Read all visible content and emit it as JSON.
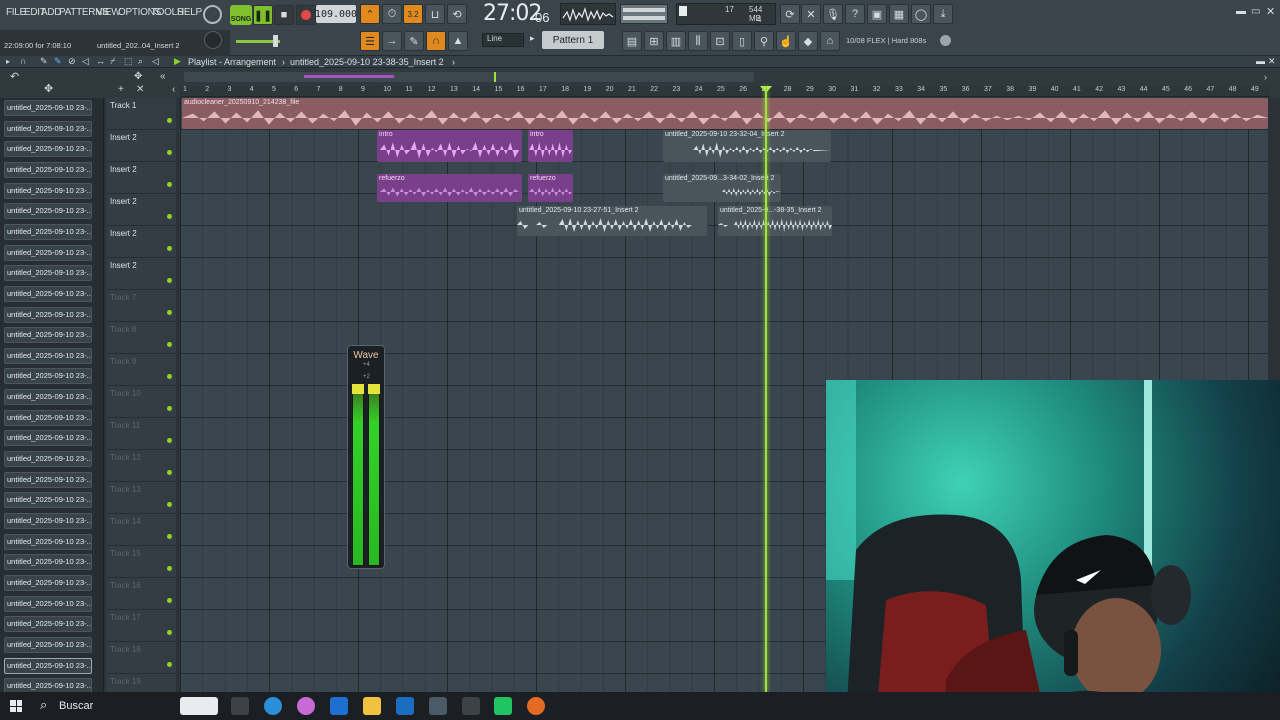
{
  "menu": [
    "FILE",
    "EDIT",
    "ADD",
    "PATTERNS",
    "VIEW",
    "OPTIONS",
    "TOOLS",
    "HELP"
  ],
  "transport": {
    "song_label": "SONG",
    "tempo": "109.000",
    "time_main": "27:02",
    "time_sub": "06"
  },
  "cpu": {
    "value1": "17",
    "ram": "544 MB",
    "value2": "4"
  },
  "hint": {
    "time": "22:09:00 for 7:08:10",
    "file": "untitled_202..04_Insert 2"
  },
  "pattern": {
    "snap": "Line",
    "selected": "Pattern 1"
  },
  "plugin_info": "10/08 FLEX | Hard 808s",
  "playlist": {
    "title": "Playlist - Arrangement",
    "separator": "›",
    "arrangement": "untitled_2025-09-10 23-38-35_Insert 2"
  },
  "ruler": [
    "1",
    "2",
    "3",
    "4",
    "5",
    "6",
    "7",
    "8",
    "9",
    "10",
    "11",
    "12",
    "13",
    "14",
    "15",
    "16",
    "17",
    "18",
    "19",
    "20",
    "21",
    "22",
    "23",
    "24",
    "25",
    "26",
    "27",
    "28",
    "29",
    "30",
    "31",
    "32",
    "33",
    "34",
    "35",
    "36",
    "37",
    "38",
    "39",
    "40",
    "41",
    "42",
    "43",
    "44",
    "45",
    "46",
    "47",
    "48",
    "49"
  ],
  "sidebar": [
    "untitled_2025-09-10 23-...",
    "untitled_2025-09-10 23-...",
    "untitled_2025-09-10 23-...",
    "untitled_2025-09-10 23-...",
    "untitled_2025-09-10 23-...",
    "untitled_2025-09-10 23-...",
    "untitled_2025-09-10 23-...",
    "untitled_2025-09-10 23-...",
    "untitled_2025-09-10 23-...",
    "untitled_2025-09-10 23-...",
    "untitled_2025-09-10 23-...",
    "untitled_2025-09-10 23-...",
    "untitled_2025-09-10 23-...",
    "untitled_2025-09-10 23-...",
    "untitled_2025-09-10 23-...",
    "untitled_2025-09-10 23-...",
    "untitled_2025-09-10 23-...",
    "untitled_2025-09-10 23-...",
    "untitled_2025-09-10 23-...",
    "untitled_2025-09-10 23-...",
    "untitled_2025-09-10 23-...",
    "untitled_2025-09-10 23-...",
    "untitled_2025-09-10 23-...",
    "untitled_2025-09-10 23-...",
    "untitled_2025-09-10 23-...",
    "untitled_2025-09-10 23-...",
    "untitled_2025-09-10 23-...",
    "untitled_2025-09-10 23-...",
    "untitled_2025-09-10 23-..."
  ],
  "tracks": [
    "Track 1",
    "Insert 2",
    "Insert 2",
    "Insert 2",
    "Insert 2",
    "Insert 2",
    "Track 7",
    "Track 8",
    "Track 9",
    "Track 10",
    "Track 11",
    "Track 12",
    "Track 13",
    "Track 14",
    "Track 15",
    "Track 16",
    "Track 17",
    "Track 18",
    "Track 19"
  ],
  "clips": {
    "audio": "audiocleaner_20250910_214238_file",
    "intro1": "intro",
    "intro2": "intro",
    "refuerzo1": "refuerzo",
    "refuerzo2": "refuerzo",
    "u1": "untitled_2025-09-10 23-32-04_Insert 2",
    "u2": "untitled_2025-09...3-34-02_Insert 2",
    "u3": "untitled_2025-09-10 23-27-51_Insert 2",
    "u4": "untitled_2025-0...-38-35_Insert 2"
  },
  "meter": {
    "title": "Wave",
    "scale_top": "+4",
    "scale_mid": "+2"
  },
  "taskbar": {
    "search": "Buscar"
  },
  "colors": {
    "accent": "#e08a1e",
    "playhead": "#9ee23a",
    "clip_pink": "#7a3f8a",
    "clip_gray": "#4a555b"
  }
}
